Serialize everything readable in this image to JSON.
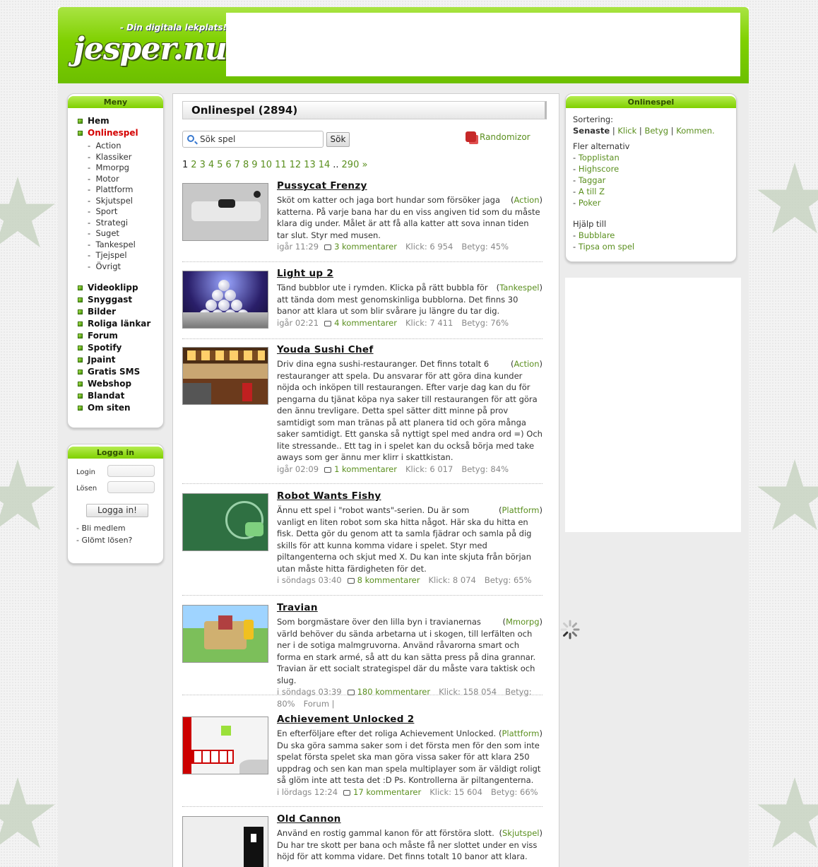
{
  "header": {
    "slogan": "- Din digitala lekplats!",
    "logo_text": "jesper.nu"
  },
  "menu": {
    "title": "Meny",
    "items_top": [
      "Hem",
      "Onlinespel"
    ],
    "sub_items": [
      "Action",
      "Klassiker",
      "Mmorpg",
      "Motor",
      "Plattform",
      "Skjutspel",
      "Sport",
      "Strategi",
      "Suget",
      "Tankespel",
      "Tjejspel",
      "Övrigt"
    ],
    "items_bottom": [
      "Videoklipp",
      "Snyggast",
      "Bilder",
      "Roliga länkar",
      "Forum",
      "Spotify",
      "Jpaint",
      "Gratis SMS",
      "Webshop",
      "Blandat",
      "Om siten"
    ]
  },
  "login": {
    "title": "Logga in",
    "login_label": "Login",
    "password_label": "Lösen",
    "button": "Logga in!",
    "links": [
      "- Bli medlem",
      "- Glömt lösen?"
    ]
  },
  "content": {
    "title": "Onlinespel (2894)",
    "search_placeholder": "Sök spel",
    "search_button": "Sök",
    "randomizer": "Randomizor",
    "pager": [
      "1",
      "2",
      "3",
      "4",
      "5",
      "6",
      "7",
      "8",
      "9",
      "10",
      "11",
      "12",
      "13",
      "14",
      "..",
      "290 »"
    ],
    "current_page": "1"
  },
  "games": [
    {
      "title": "Pussycat Frenzy",
      "category": "Action",
      "desc": "Sköt om katter och jaga bort hundar som försöker jaga katterna. På varje bana har du en viss angiven tid som du måste klara dig under. Målet är att få alla katter att sova innan tiden tar slut. Styr med musen.",
      "date": "igår 11:29",
      "comments": "3 kommentarer",
      "clicks": "Klick: 6 954",
      "rating": "Betyg: 45%"
    },
    {
      "title": "Light up 2",
      "category": "Tankespel",
      "desc": "Tänd bubblor ute i rymden. Klicka på rätt bubbla för att tända dom mest genomskinliga bubblorna. Det finns 30 banor att klara ut som blir svårare ju längre du tar dig.",
      "date": "igår 02:21",
      "comments": "4 kommentarer",
      "clicks": "Klick: 7 411",
      "rating": "Betyg: 76%"
    },
    {
      "title": "Youda Sushi Chef",
      "category": "Action",
      "desc": "Driv dina egna sushi-restauranger. Det finns totalt 6 restauranger att spela. Du ansvarar för att göra dina kunder nöjda och inköpen till restaurangen. Efter varje dag kan du för pengarna du tjänat köpa nya saker till restaurangen för att göra den ännu trevligare. Detta spel sätter ditt minne på prov samtidigt som man tränas på att planera tid och göra många saker samtidigt. Ett ganska så nyttigt spel med andra ord =) Och lite stressande.. Ett tag in i spelet kan du också börja med take aways som ger ännu mer klirr i skattkistan.",
      "date": "igår 02:09",
      "comments": "1 kommentarer",
      "clicks": "Klick: 6 017",
      "rating": "Betyg: 84%"
    },
    {
      "title": "Robot Wants Fishy",
      "category": "Plattform",
      "desc": "Ännu ett spel i \"robot wants\"-serien. Du är som vanligt en liten robot som ska hitta något. Här ska du hitta en fisk. Detta gör du genom att ta samla fjädrar och samla på dig skills för att kunna komma vidare i spelet. Styr med piltangenterna och skjut med X. Du kan inte skjuta från början utan måste hitta färdigheten för det.",
      "date": "i söndags 03:40",
      "comments": "8 kommentarer",
      "clicks": "Klick: 8 074",
      "rating": "Betyg: 65%"
    },
    {
      "title": "Travian",
      "category": "Mmorpg",
      "desc": "Som borgmästare över den lilla byn i travianernas värld behöver du sända arbetarna ut i skogen, till lerfälten och ner i de sotiga malmgruvorna. Använd råvarorna smart och forma en stark armé, så att du kan sätta press på dina grannar. Travian är ett socialt strategispel där du måste vara taktisk och slug.",
      "date": "i söndags 03:39",
      "comments": "180 kommentarer",
      "clicks": "Klick: 158 054",
      "rating": "Betyg: 80%",
      "extra": "Forum |"
    },
    {
      "title": "Achievement Unlocked 2",
      "category": "Plattform",
      "desc": "En efterföljare efter det roliga Achievement Unlocked. Du ska göra samma saker som i det första men för den som inte spelat första spelet ska man göra vissa saker för att klara 250 uppdrag och sen kan man spela multiplayer som är väldigt roligt så glöm inte att testa det :D Ps. Kontrollerna är piltangenterna.",
      "date": "i lördags 12:24",
      "comments": "17 kommentarer",
      "clicks": "Klick: 15 604",
      "rating": "Betyg: 66%"
    },
    {
      "title": "Old Cannon",
      "category": "Skjutspel",
      "desc": "Använd en rostig gammal kanon för att förstöra slott. Du har tre skott per bana och måste få ner slottet under en viss höjd för att komma vidare. Det finns totalt 10 banor att klara."
    }
  ],
  "right": {
    "title": "Onlinespel",
    "sort_label": "Sortering:",
    "sort_options": [
      "Senaste",
      "Klick",
      "Betyg",
      "Kommen."
    ],
    "more_label": "Fler alternativ",
    "more_links": [
      "Topplistan",
      "Highscore",
      "Taggar",
      "A till Z",
      "Poker"
    ],
    "help_label": "Hjälp till",
    "help_links": [
      "Bubblare",
      "Tipsa om spel"
    ]
  },
  "colors": {
    "brand_green": "#7fd000",
    "link_green": "#5a8f1e",
    "active_red": "#d40000"
  }
}
